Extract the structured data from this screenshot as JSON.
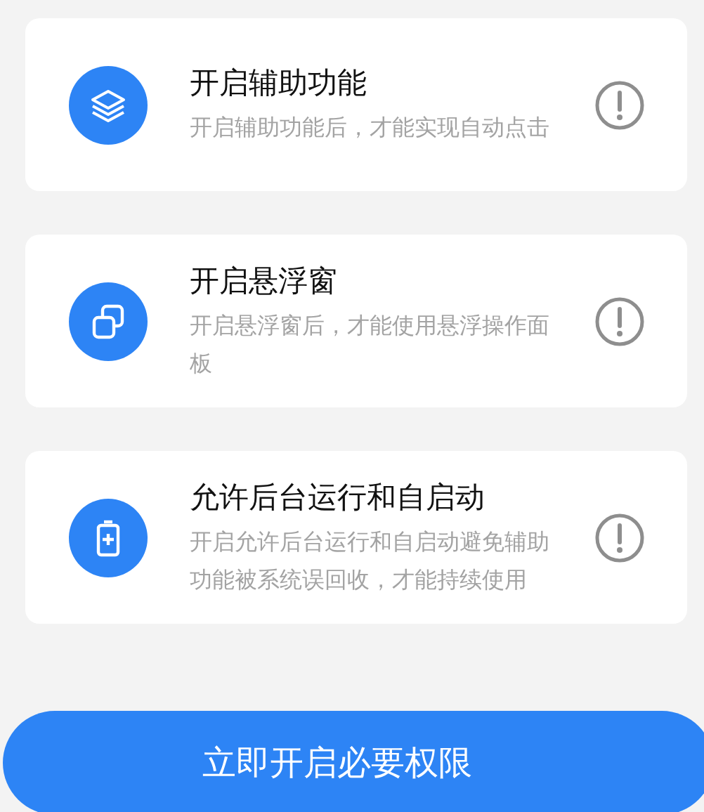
{
  "permissions": [
    {
      "kind": "layers",
      "title": "开启辅助功能",
      "description": "开启辅助功能后，才能实现自动点击"
    },
    {
      "kind": "windows",
      "title": "开启悬浮窗",
      "description": "开启悬浮窗后，才能使用悬浮操作面板"
    },
    {
      "kind": "battery",
      "title": "允许后台运行和自启动",
      "description": "开启允许后台运行和自启动避免辅助功能被系统误回收，才能持续使用"
    }
  ],
  "button": {
    "label": "立即开启必要权限"
  }
}
